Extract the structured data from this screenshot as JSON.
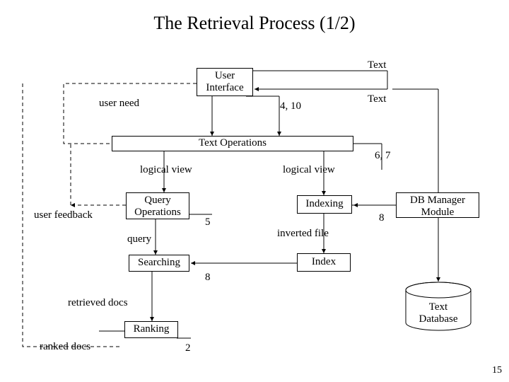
{
  "title": "The Retrieval Process (1/2)",
  "boxes": {
    "user_interface": "User\nInterface",
    "text_operations": "Text   Operations",
    "query_operations": "Query\nOperations",
    "indexing": "Indexing",
    "db_manager": "DB Manager\nModule",
    "searching": "Searching",
    "index": "Index",
    "ranking": "Ranking",
    "text_database": "Text\nDatabase"
  },
  "labels": {
    "text_top": "Text",
    "text_right": "Text",
    "user_need": "user need",
    "logical_view_left": "logical view",
    "logical_view_right": "logical view",
    "user_feedback": "user feedback",
    "query": "query",
    "inverted_file": "inverted file",
    "retrieved_docs": "retrieved docs",
    "ranked_docs": "ranked docs"
  },
  "edge_nums": {
    "n4_10": "4, 10",
    "n6_7": "6, 7",
    "n5": "5",
    "n8_top": "8",
    "n8_bottom": "8",
    "n2": "2"
  },
  "page_number": "15"
}
